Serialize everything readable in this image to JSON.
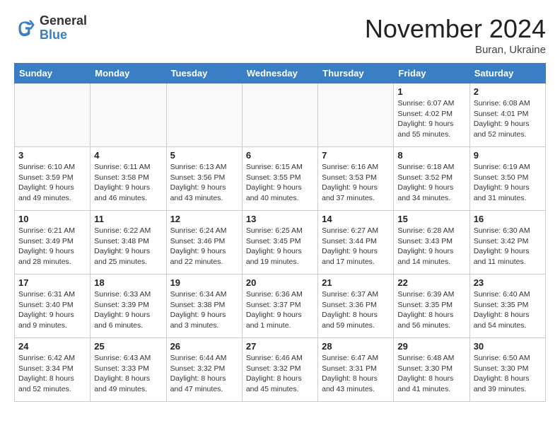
{
  "header": {
    "logo_general": "General",
    "logo_blue": "Blue",
    "month_title": "November 2024",
    "location": "Buran, Ukraine"
  },
  "weekdays": [
    "Sunday",
    "Monday",
    "Tuesday",
    "Wednesday",
    "Thursday",
    "Friday",
    "Saturday"
  ],
  "weeks": [
    [
      {
        "day": "",
        "info": ""
      },
      {
        "day": "",
        "info": ""
      },
      {
        "day": "",
        "info": ""
      },
      {
        "day": "",
        "info": ""
      },
      {
        "day": "",
        "info": ""
      },
      {
        "day": "1",
        "info": "Sunrise: 6:07 AM\nSunset: 4:02 PM\nDaylight: 9 hours\nand 55 minutes."
      },
      {
        "day": "2",
        "info": "Sunrise: 6:08 AM\nSunset: 4:01 PM\nDaylight: 9 hours\nand 52 minutes."
      }
    ],
    [
      {
        "day": "3",
        "info": "Sunrise: 6:10 AM\nSunset: 3:59 PM\nDaylight: 9 hours\nand 49 minutes."
      },
      {
        "day": "4",
        "info": "Sunrise: 6:11 AM\nSunset: 3:58 PM\nDaylight: 9 hours\nand 46 minutes."
      },
      {
        "day": "5",
        "info": "Sunrise: 6:13 AM\nSunset: 3:56 PM\nDaylight: 9 hours\nand 43 minutes."
      },
      {
        "day": "6",
        "info": "Sunrise: 6:15 AM\nSunset: 3:55 PM\nDaylight: 9 hours\nand 40 minutes."
      },
      {
        "day": "7",
        "info": "Sunrise: 6:16 AM\nSunset: 3:53 PM\nDaylight: 9 hours\nand 37 minutes."
      },
      {
        "day": "8",
        "info": "Sunrise: 6:18 AM\nSunset: 3:52 PM\nDaylight: 9 hours\nand 34 minutes."
      },
      {
        "day": "9",
        "info": "Sunrise: 6:19 AM\nSunset: 3:50 PM\nDaylight: 9 hours\nand 31 minutes."
      }
    ],
    [
      {
        "day": "10",
        "info": "Sunrise: 6:21 AM\nSunset: 3:49 PM\nDaylight: 9 hours\nand 28 minutes."
      },
      {
        "day": "11",
        "info": "Sunrise: 6:22 AM\nSunset: 3:48 PM\nDaylight: 9 hours\nand 25 minutes."
      },
      {
        "day": "12",
        "info": "Sunrise: 6:24 AM\nSunset: 3:46 PM\nDaylight: 9 hours\nand 22 minutes."
      },
      {
        "day": "13",
        "info": "Sunrise: 6:25 AM\nSunset: 3:45 PM\nDaylight: 9 hours\nand 19 minutes."
      },
      {
        "day": "14",
        "info": "Sunrise: 6:27 AM\nSunset: 3:44 PM\nDaylight: 9 hours\nand 17 minutes."
      },
      {
        "day": "15",
        "info": "Sunrise: 6:28 AM\nSunset: 3:43 PM\nDaylight: 9 hours\nand 14 minutes."
      },
      {
        "day": "16",
        "info": "Sunrise: 6:30 AM\nSunset: 3:42 PM\nDaylight: 9 hours\nand 11 minutes."
      }
    ],
    [
      {
        "day": "17",
        "info": "Sunrise: 6:31 AM\nSunset: 3:40 PM\nDaylight: 9 hours\nand 9 minutes."
      },
      {
        "day": "18",
        "info": "Sunrise: 6:33 AM\nSunset: 3:39 PM\nDaylight: 9 hours\nand 6 minutes."
      },
      {
        "day": "19",
        "info": "Sunrise: 6:34 AM\nSunset: 3:38 PM\nDaylight: 9 hours\nand 3 minutes."
      },
      {
        "day": "20",
        "info": "Sunrise: 6:36 AM\nSunset: 3:37 PM\nDaylight: 9 hours\nand 1 minute."
      },
      {
        "day": "21",
        "info": "Sunrise: 6:37 AM\nSunset: 3:36 PM\nDaylight: 8 hours\nand 59 minutes."
      },
      {
        "day": "22",
        "info": "Sunrise: 6:39 AM\nSunset: 3:35 PM\nDaylight: 8 hours\nand 56 minutes."
      },
      {
        "day": "23",
        "info": "Sunrise: 6:40 AM\nSunset: 3:35 PM\nDaylight: 8 hours\nand 54 minutes."
      }
    ],
    [
      {
        "day": "24",
        "info": "Sunrise: 6:42 AM\nSunset: 3:34 PM\nDaylight: 8 hours\nand 52 minutes."
      },
      {
        "day": "25",
        "info": "Sunrise: 6:43 AM\nSunset: 3:33 PM\nDaylight: 8 hours\nand 49 minutes."
      },
      {
        "day": "26",
        "info": "Sunrise: 6:44 AM\nSunset: 3:32 PM\nDaylight: 8 hours\nand 47 minutes."
      },
      {
        "day": "27",
        "info": "Sunrise: 6:46 AM\nSunset: 3:32 PM\nDaylight: 8 hours\nand 45 minutes."
      },
      {
        "day": "28",
        "info": "Sunrise: 6:47 AM\nSunset: 3:31 PM\nDaylight: 8 hours\nand 43 minutes."
      },
      {
        "day": "29",
        "info": "Sunrise: 6:48 AM\nSunset: 3:30 PM\nDaylight: 8 hours\nand 41 minutes."
      },
      {
        "day": "30",
        "info": "Sunrise: 6:50 AM\nSunset: 3:30 PM\nDaylight: 8 hours\nand 39 minutes."
      }
    ]
  ]
}
